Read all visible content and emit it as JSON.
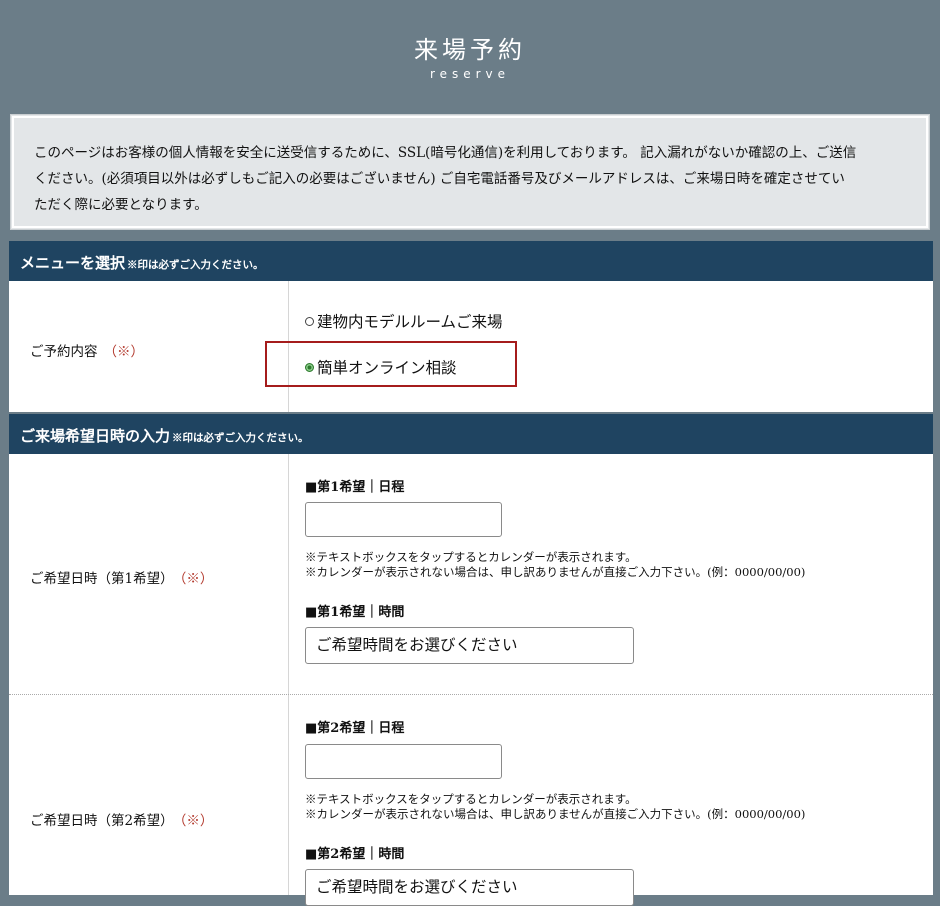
{
  "header": {
    "title": "来場予約",
    "subtitle": "reserve"
  },
  "notice": {
    "line1": "このページはお客様の個人情報を安全に送受信するために、SSL(暗号化通信)を利用しております。 記入漏れがないか確認の上、ご送信",
    "line2": "ください。(必須項目以外は必ずしもご記入の必要はございません) ご自宅電話番号及びメールアドレスは、ご来場日時を確定させてい",
    "line3": "ただく際に必要となります。"
  },
  "section_menu": {
    "title": "メニューを選択",
    "note": "※印は必ずご入力ください。",
    "row_label": "ご予約内容",
    "required_mark": "（※）",
    "options": [
      {
        "label": "建物内モデルルームご来場",
        "selected": false
      },
      {
        "label": "簡単オンライン相談",
        "selected": true
      }
    ]
  },
  "section_date": {
    "title": "ご来場希望日時の入力",
    "note": "※印は必ずご入力ください。",
    "rows": [
      {
        "label": "ご希望日時（第1希望）",
        "required_mark": "（※）",
        "date_head": "■第1希望｜日程",
        "date_value": "",
        "hint1": "※テキストボックスをタップするとカレンダーが表示されます。",
        "hint2": "※カレンダーが表示されない場合は、申し訳ありませんが直接ご入力下さい。(例：0000/00/00)",
        "time_head": "■第1希望｜時間",
        "time_value": "ご希望時間をお選びください"
      },
      {
        "label": "ご希望日時（第2希望）",
        "required_mark": "（※）",
        "date_head": "■第2希望｜日程",
        "date_value": "",
        "hint1": "※テキストボックスをタップするとカレンダーが表示されます。",
        "hint2": "※カレンダーが表示されない場合は、申し訳ありませんが直接ご入力下さい。(例：0000/00/00)",
        "time_head": "■第2希望｜時間",
        "time_value": "ご希望時間をお選びください"
      }
    ]
  },
  "colors": {
    "background": "#6b7d88",
    "section_bar": "#1f4461",
    "required": "#b33a2e",
    "highlight": "#a51c1c"
  }
}
